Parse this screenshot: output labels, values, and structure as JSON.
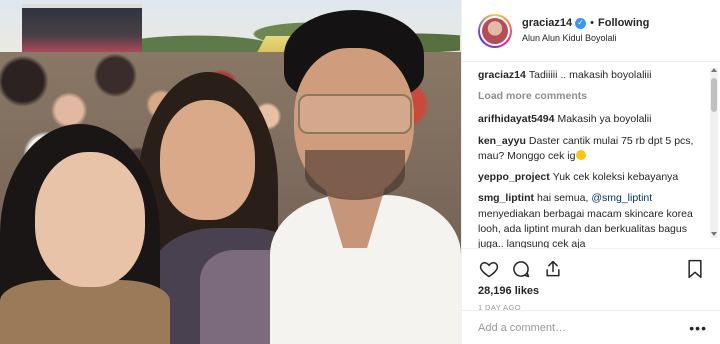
{
  "post": {
    "username": "graciaz14",
    "verified_mark": "✓",
    "separator": "•",
    "follow_status": "Following",
    "location": "Alun Alun Kidul Boyolali",
    "caption_user": "graciaz14",
    "caption_text": "Tadiiiii .. makasih boyolaliii",
    "load_more": "Load more comments",
    "comments": [
      {
        "user": "arifhidayat5494",
        "text": "Makasih ya boyolalii"
      },
      {
        "user": "ken_ayyu",
        "text": "Daster cantik mulai 75 rb dpt 5 pcs, mau? Monggo cek ig"
      },
      {
        "user": "yeppo_project",
        "text": "Yuk cek koleksi kebayanya"
      },
      {
        "user": "smg_liptint",
        "text_before": "hai semua,",
        "mention": "@smg_liptint",
        "text_after": "menyediakan berbagai macam skincare korea looh, ada liptint murah dan berkualitas bagus juga.. langsung cek aja"
      }
    ],
    "likes": "28,196 likes",
    "date": "1 DAY AGO",
    "add_comment_placeholder": "Add a comment…",
    "more_label": "•••"
  },
  "icons": {
    "like": "heart-icon",
    "comment": "comment-icon",
    "share": "share-icon",
    "save": "bookmark-icon",
    "emoji": "smile-emoji-icon"
  },
  "colors": {
    "verified": "#3897f0",
    "muted": "#8e8e8e",
    "text": "#262626",
    "mention": "#003569"
  }
}
